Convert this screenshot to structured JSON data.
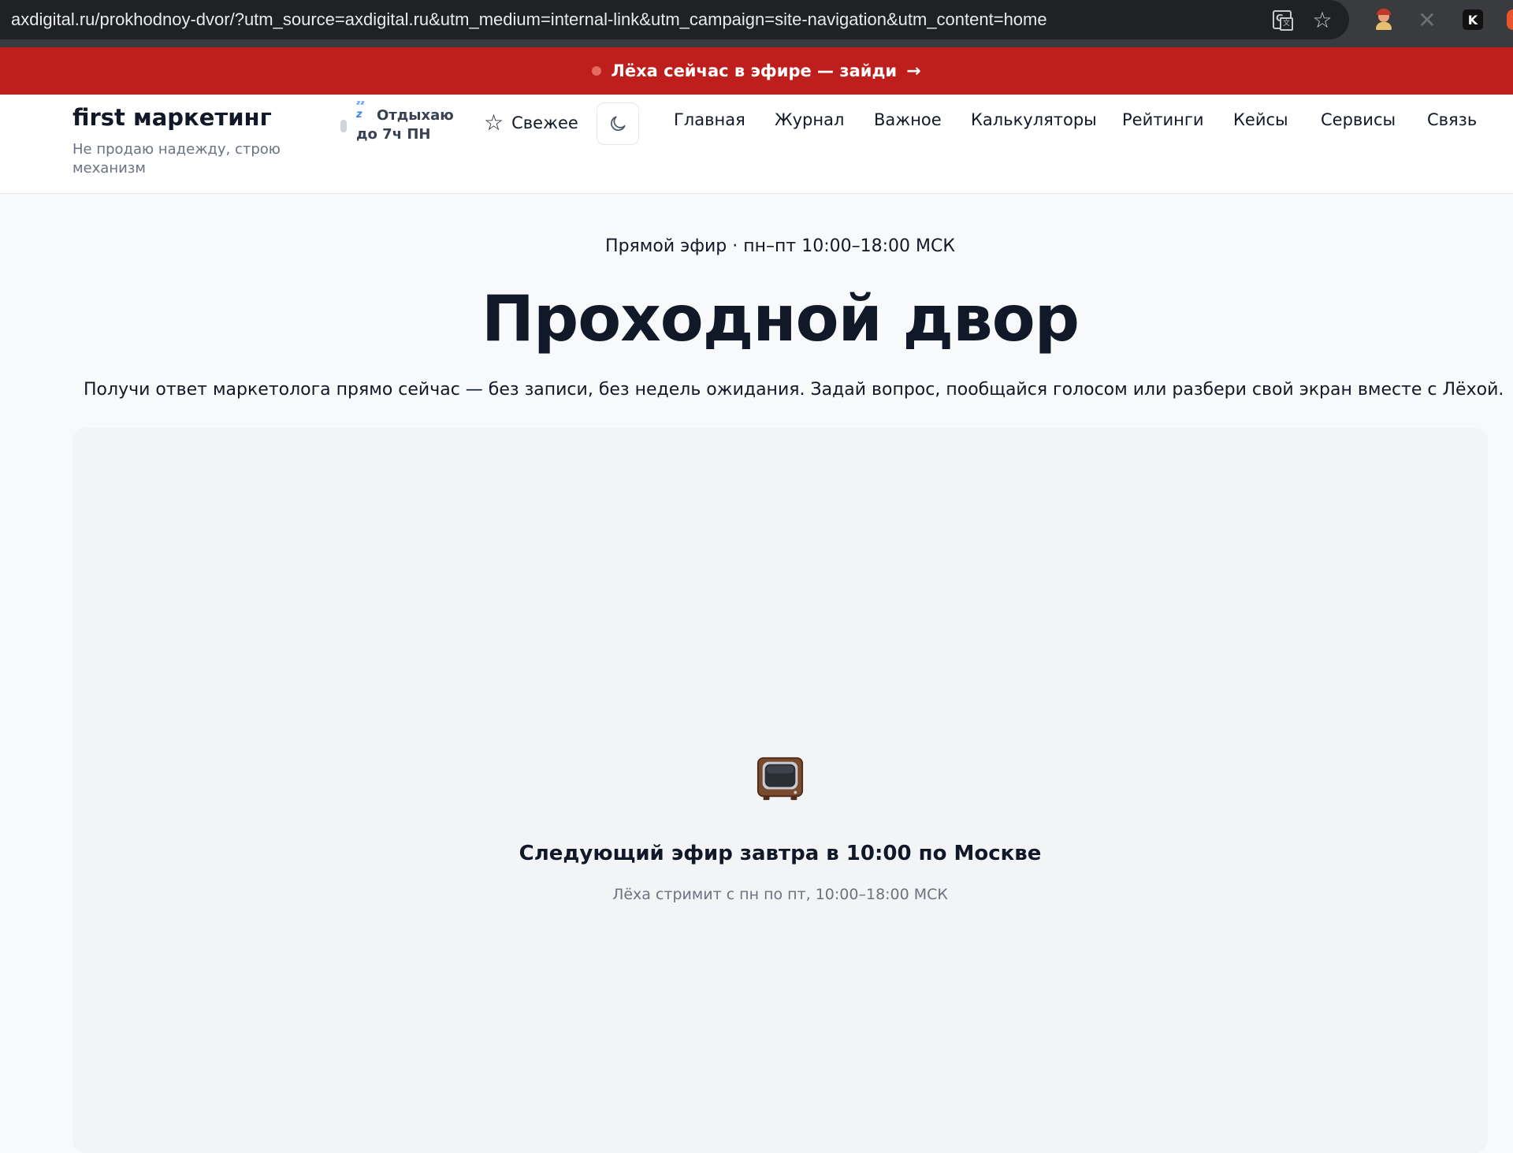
{
  "browser": {
    "url": "axdigital.ru/prokhodnoy-dvor/?utm_source=axdigital.ru&utm_medium=internal-link&utm_campaign=site-navigation&utm_content=home",
    "extensions": [
      "translate-icon",
      "star-bookmark-icon",
      "person-extension-icon",
      "x-extension-icon",
      "k-extension-icon"
    ],
    "k_label": "K"
  },
  "banner": {
    "text": "Лёха сейчас в эфире — зайди",
    "arrow": "→",
    "color": "#bf1f1c"
  },
  "header": {
    "logo": "first маркетинг",
    "tagline": "Не продаю надежду, строю механизм",
    "status_line1": "Отдыхаю",
    "status_line2": "до 7ч ПН",
    "fresh_label": "Свежее",
    "nav": [
      {
        "label": "Главная"
      },
      {
        "label": "Журнал"
      },
      {
        "label": "Важное"
      },
      {
        "label": "Калькуляторы"
      },
      {
        "label": "Рейтинги"
      },
      {
        "label": "Кейсы"
      },
      {
        "label": "Сервисы"
      },
      {
        "label": "Связь"
      }
    ]
  },
  "main": {
    "kicker": "Прямой эфир · пн–пт 10:00–18:00 МСК",
    "title": "Проходной двор",
    "subtitle": "Получи ответ маркетолога прямо сейчас — без записи, без недель ожидания. Задай вопрос, пообщайся голосом или разбери свой экран вместе с Лёхой.",
    "next_air": "Следующий эфир завтра в 10:00 по Москве",
    "schedule_note": "Лёха стримит с пн по пт, 10:00–18:00 МСК"
  }
}
